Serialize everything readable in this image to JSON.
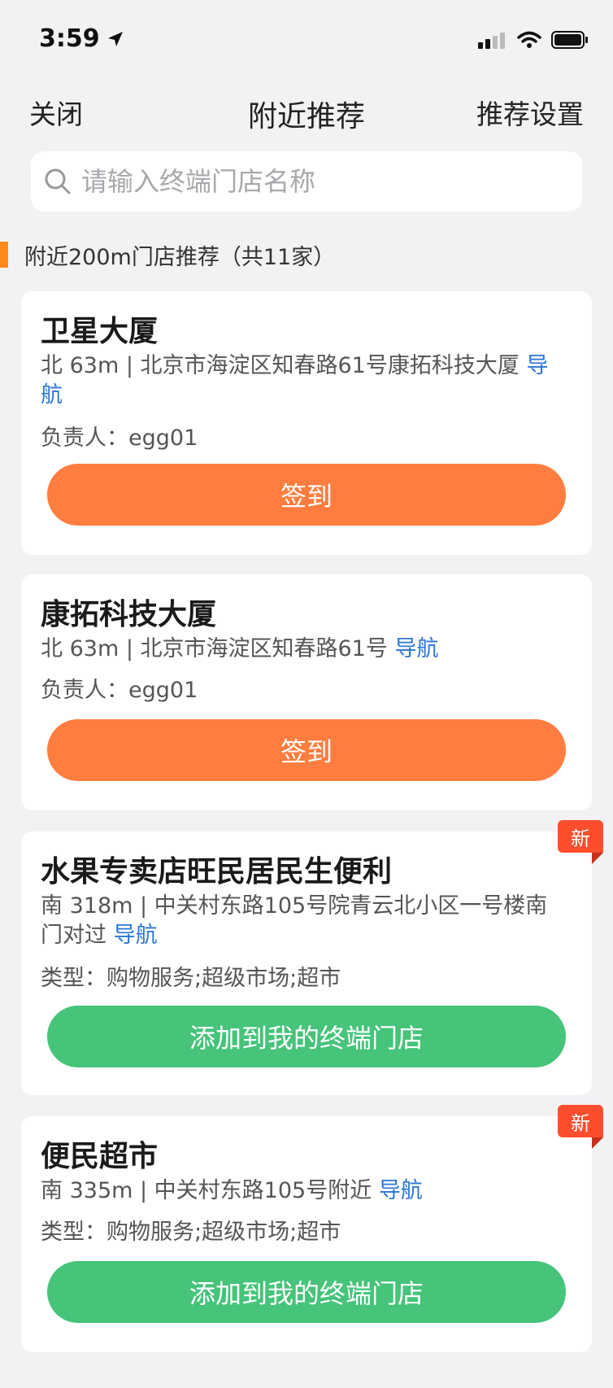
{
  "status": {
    "time": "3:59"
  },
  "nav": {
    "close": "关闭",
    "title": "附近推荐",
    "settings": "推荐设置"
  },
  "search": {
    "placeholder": "请输入终端门店名称"
  },
  "section": {
    "title": "附近200m门店推荐（共11家）"
  },
  "stores": [
    {
      "name": "卫星大厦",
      "addr": "北 63m | 北京市海淀区知春路61号康拓科技大厦",
      "nav": "导航",
      "meta": "负责人：egg01",
      "action": "签到"
    },
    {
      "name": "康拓科技大厦",
      "addr": "北 63m | 北京市海淀区知春路61号",
      "nav": "导航",
      "meta": "负责人：egg01",
      "action": "签到"
    },
    {
      "name": "水果专卖店旺民居民生便利",
      "addr": "南 318m | 中关村东路105号院青云北小区一号楼南门对过",
      "nav": "导航",
      "meta": "类型：购物服务;超级市场;超市",
      "action": "添加到我的终端门店",
      "badge": "新"
    },
    {
      "name": "便民超市",
      "addr": "南 335m | 中关村东路105号附近",
      "nav": "导航",
      "meta": "类型：购物服务;超级市场;超市",
      "action": "添加到我的终端门店",
      "badge": "新"
    }
  ]
}
